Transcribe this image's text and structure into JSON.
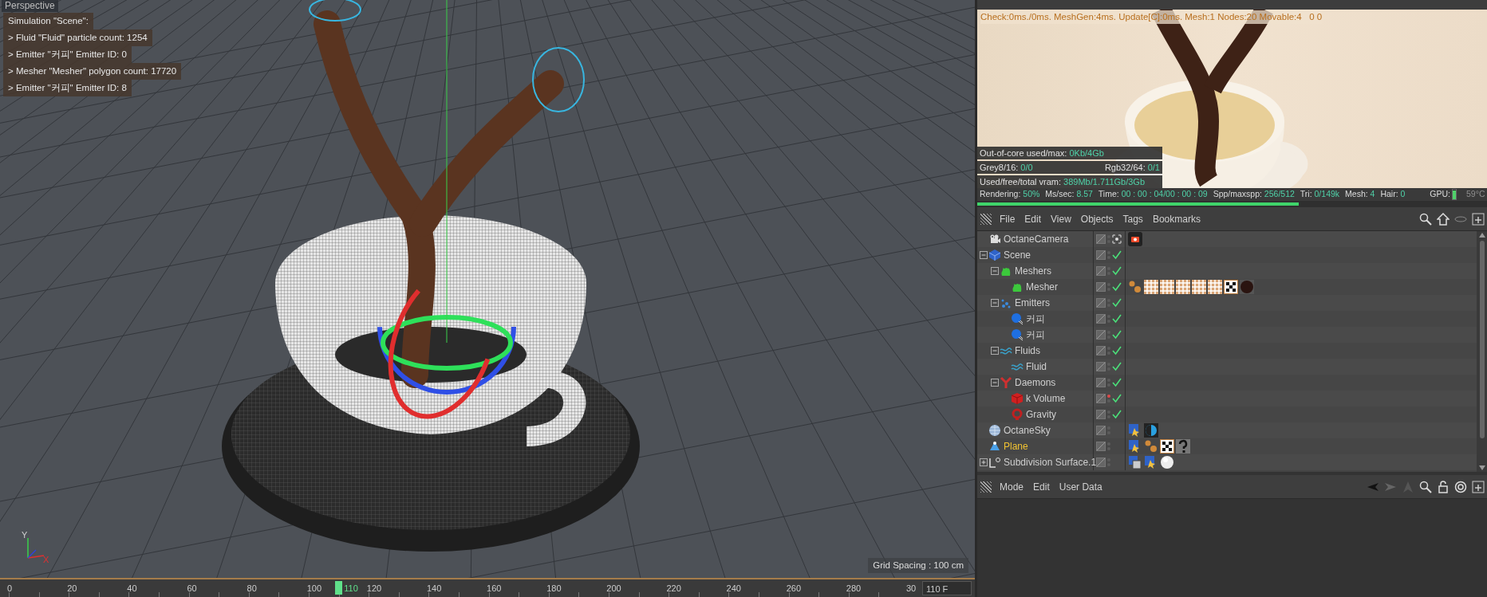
{
  "viewport": {
    "title": "Perspective",
    "simulation": {
      "title": "Simulation \"Scene\":",
      "lines": [
        "> Fluid \"Fluid\" particle count: 1254",
        "> Emitter \"커피\" Emitter ID: 0",
        "> Mesher \"Mesher\" polygon count: 17720",
        "> Emitter \"커피\" Emitter ID: 8"
      ]
    },
    "axes": [
      "Y",
      "X"
    ],
    "grid_spacing": "Grid Spacing : 100 cm"
  },
  "timeline": {
    "ticks": [
      "0",
      "20",
      "40",
      "60",
      "80",
      "100",
      "120",
      "140",
      "160",
      "180",
      "200",
      "220",
      "240",
      "260",
      "280",
      "30"
    ],
    "current": "110",
    "level": 0.3667,
    "frame_field": "110 F"
  },
  "render": {
    "stats": "Check:0ms./0ms. MeshGen:4ms. Update[C]:0ms. Mesh:1 Nodes:20 Movable:4   0 0",
    "memory": [
      [
        {
          "label": "Out-of-core used/max:",
          "value": "0Kb/4Gb"
        }
      ],
      [
        {
          "label": "Grey8/16:",
          "value": "0/0"
        },
        {
          "label": "Rgb32/64:",
          "value": "0/1"
        }
      ],
      [
        {
          "label": "Used/free/total vram:",
          "value": "389Mb/1.711Gb/3Gb"
        }
      ]
    ],
    "status": [
      {
        "label": "Rendering:",
        "value": "50%"
      },
      {
        "label": "Ms/sec:",
        "value": "8.57"
      },
      {
        "label": "Time:",
        "value": "00 : 00 : 04/00 : 00 : 09"
      },
      {
        "label": "Spp/maxspp:",
        "value": "256/512"
      },
      {
        "label": "Tri:",
        "value": "0/149k"
      },
      {
        "label": "Mesh:",
        "value": "4"
      },
      {
        "label": "Hair:",
        "value": "0"
      }
    ],
    "gpu": {
      "label": "GPU:",
      "level": 0.9,
      "temperature": "59°C"
    },
    "level": 0.63
  },
  "object_manager": {
    "menu": [
      "File",
      "Edit",
      "View",
      "Objects",
      "Tags",
      "Bookmarks"
    ],
    "objects": [
      {
        "name": "OctaneCamera",
        "kind": "camera",
        "selected": false,
        "enabled": false,
        "editor_on": false,
        "tags": [
          {
            "kind": "camera"
          }
        ]
      },
      {
        "name": "Scene",
        "kind": "scene",
        "selected": false,
        "enabled": true,
        "editor_on": false,
        "expanded": true,
        "children": [
          {
            "name": "Meshers",
            "kind": "meshers",
            "selected": false,
            "enabled": true,
            "editor_on": false,
            "expanded": true,
            "children": [
              {
                "name": "Mesher",
                "kind": "mesher",
                "selected": false,
                "enabled": true,
                "editor_on": false,
                "tags": [
                  {
                    "kind": "spheres"
                  },
                  {
                    "kind": "pattern"
                  },
                  {
                    "kind": "pattern"
                  },
                  {
                    "kind": "pattern"
                  },
                  {
                    "kind": "pattern"
                  },
                  {
                    "kind": "pattern"
                  },
                  {
                    "kind": "checker"
                  },
                  {
                    "kind": "dark-sphere"
                  }
                ]
              }
            ]
          },
          {
            "name": "Emitters",
            "kind": "emitters",
            "selected": false,
            "enabled": true,
            "editor_on": false,
            "expanded": true,
            "children": [
              {
                "name": "커피",
                "kind": "emitter",
                "selected": false,
                "enabled": true,
                "editor_on": false
              },
              {
                "name": "커피",
                "kind": "emitter",
                "selected": false,
                "enabled": true,
                "editor_on": false
              }
            ]
          },
          {
            "name": "Fluids",
            "kind": "fluids",
            "selected": false,
            "enabled": true,
            "editor_on": false,
            "expanded": true,
            "children": [
              {
                "name": "Fluid",
                "kind": "fluid",
                "selected": false,
                "enabled": true,
                "editor_on": false
              }
            ]
          },
          {
            "name": "Daemons",
            "kind": "daemons",
            "selected": false,
            "enabled": true,
            "editor_on": false,
            "expanded": true,
            "children": [
              {
                "name": "k Volume",
                "kind": "volume",
                "selected": false,
                "enabled": true,
                "editor_on": true
              },
              {
                "name": "Gravity",
                "kind": "gravity",
                "selected": false,
                "enabled": true,
                "editor_on": false
              }
            ]
          }
        ]
      },
      {
        "name": "OctaneSky",
        "kind": "sky",
        "selected": false,
        "enabled": false,
        "editor_on": false,
        "tags": [
          {
            "kind": "star-tag"
          },
          {
            "kind": "half-disc"
          }
        ]
      },
      {
        "name": "Plane",
        "kind": "plane",
        "selected": true,
        "enabled": false,
        "editor_on": false,
        "tags": [
          {
            "kind": "star-tag"
          },
          {
            "kind": "spheres"
          },
          {
            "kind": "checker"
          },
          {
            "kind": "question"
          }
        ]
      },
      {
        "name": "Subdivision Surface.1",
        "kind": "subdivision",
        "selected": false,
        "enabled": false,
        "editor_on": false,
        "expanded": false,
        "tags": [
          {
            "kind": "cube-tag"
          },
          {
            "kind": "star-tag"
          },
          {
            "kind": "white-sphere"
          }
        ]
      }
    ]
  },
  "attribute_manager": {
    "menu": [
      "Mode",
      "Edit",
      "User Data"
    ]
  }
}
